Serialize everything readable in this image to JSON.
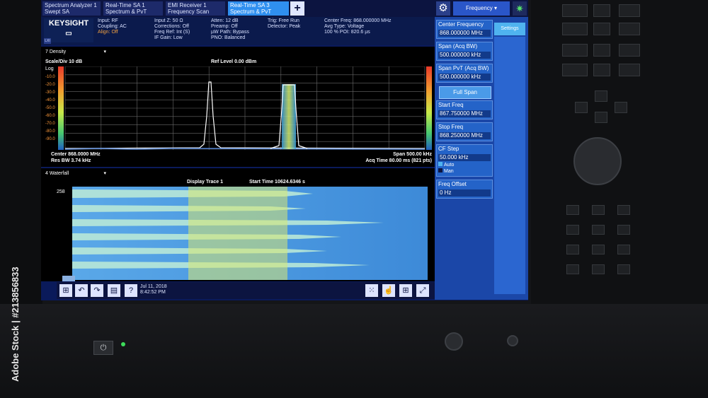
{
  "tabs": [
    {
      "line1": "Spectrum Analyzer 1",
      "line2": "Swept SA"
    },
    {
      "line1": "Real-Time SA 1",
      "line2": "Spectrum & PvT"
    },
    {
      "line1": "EMI Receiver 1",
      "line2": "Frequency Scan"
    },
    {
      "line1": "Real-Time SA 3",
      "line2": "Spectrum & PvT"
    }
  ],
  "add_tab_label": "+",
  "mode_select_label": "Frequency",
  "brand": "KEYSIGHT",
  "lxi_label": "LXI",
  "measbar": {
    "col1": [
      "Input: RF",
      "Coupling: AC",
      "Align: Off"
    ],
    "col2": [
      "Input Z: 50 Ω",
      "Corrections: Off",
      "Freq Ref: Int (S)",
      "IF Gain: Low"
    ],
    "col3": [
      "Atten: 12 dB",
      "Preamp: Off",
      "µW Path: Bypass",
      "PNO: Balanced"
    ],
    "col4": [
      "Trig: Free Run",
      "Detector: Peak"
    ],
    "col5": [
      "Center Freq: 868.000000 MHz",
      "Avg Type: Voltage",
      "100 % POI: 820.6 µs"
    ]
  },
  "window1": {
    "selector": "7 Density",
    "scale": "Scale/Div 10 dB",
    "log": "Log",
    "ref_level": "Ref Level 0.00 dBm",
    "y_ticks": [
      "-10.0",
      "-20.0",
      "-30.0",
      "-40.0",
      "-50.0",
      "-60.0",
      "-70.0",
      "-80.0",
      "-90.0"
    ],
    "center": "Center 868.0000 MHz",
    "res_bw": "Res BW 3.74 kHz",
    "span": "Span 500.00 kHz",
    "acq_time": "Acq Time 80.00 ms (821 pts)"
  },
  "window2": {
    "selector": "4 Waterfall",
    "display_trace": "Display Trace 1",
    "start_time": "Start Time 10624.6346 s",
    "y_top": "258"
  },
  "status": {
    "date": "Jul 11, 2018",
    "time": "8:42:52 PM"
  },
  "softkeys": {
    "settings_tab": "Settings",
    "items": [
      {
        "label": "Center Frequency",
        "value": "868.000000 MHz"
      },
      {
        "label": "Span (Acq BW)",
        "value": "500.000000 kHz"
      },
      {
        "label": "Span PvT (Acq BW)",
        "value": "500.000000 kHz"
      },
      {
        "label": "Start Freq",
        "value": "867.750000 MHz"
      },
      {
        "label": "Stop Freq",
        "value": "868.250000 MHz"
      },
      {
        "label": "CF Step",
        "value": "50.000 kHz"
      },
      {
        "label": "Freq Offset",
        "value": "0 Hz"
      }
    ],
    "full_span": "Full Span",
    "cf_auto": "Auto",
    "cf_man": "Man"
  },
  "watermark": "Adobe Stock | #213856833",
  "colors": {
    "screen_bg": "#0a1a5a",
    "active_tab": "#2f8ff0",
    "softkey": "#2463c8",
    "trace": "#ffffff"
  }
}
